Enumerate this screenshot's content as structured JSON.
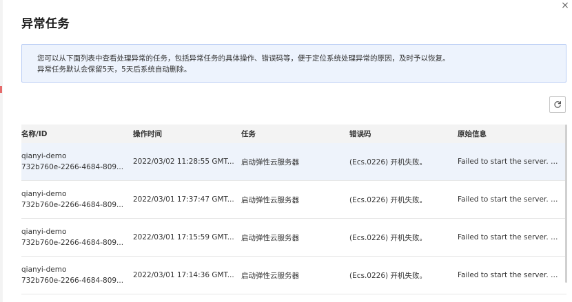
{
  "dialog": {
    "title": "异常任务",
    "close_glyph": "×"
  },
  "notice": {
    "line1": "您可以从下面列表中查看处理异常的任务，包括异常任务的具体操作、错误码等，便于定位系统处理异常的原因，及时予以恢复。",
    "line2": "异常任务默认会保留5天，5天后系统自动删除。"
  },
  "toolbar": {
    "refresh_icon": "refresh-icon"
  },
  "table": {
    "headers": [
      "名称/ID",
      "操作时间",
      "任务",
      "错误码",
      "原始信息"
    ],
    "rows": [
      {
        "name": "qianyi-demo",
        "id": "732b760e-2266-4684-809...",
        "time": "2022/03/02 11:28:55 GMT...",
        "task": "启动弹性云服务器",
        "error_code": "(Ecs.0226) 开机失败。",
        "message": "Failed to start the server. T..."
      },
      {
        "name": "qianyi-demo",
        "id": "732b760e-2266-4684-809...",
        "time": "2022/03/01 17:37:47 GMT...",
        "task": "启动弹性云服务器",
        "error_code": "(Ecs.0226) 开机失败。",
        "message": "Failed to start the server. T..."
      },
      {
        "name": "qianyi-demo",
        "id": "732b760e-2266-4684-809...",
        "time": "2022/03/01 17:15:59 GMT...",
        "task": "启动弹性云服务器",
        "error_code": "(Ecs.0226) 开机失败。",
        "message": "Failed to start the server. T..."
      },
      {
        "name": "qianyi-demo",
        "id": "732b760e-2266-4684-809...",
        "time": "2022/03/01 17:14:36 GMT...",
        "task": "启动弹性云服务器",
        "error_code": "(Ecs.0226) 开机失败。",
        "message": "Failed to start the server. T..."
      }
    ]
  },
  "colors": {
    "notice_bg": "#edf3fd",
    "notice_border": "#b9cdf5",
    "header_bg": "#f3f3f3",
    "active_row_bg": "#eef3fb"
  }
}
